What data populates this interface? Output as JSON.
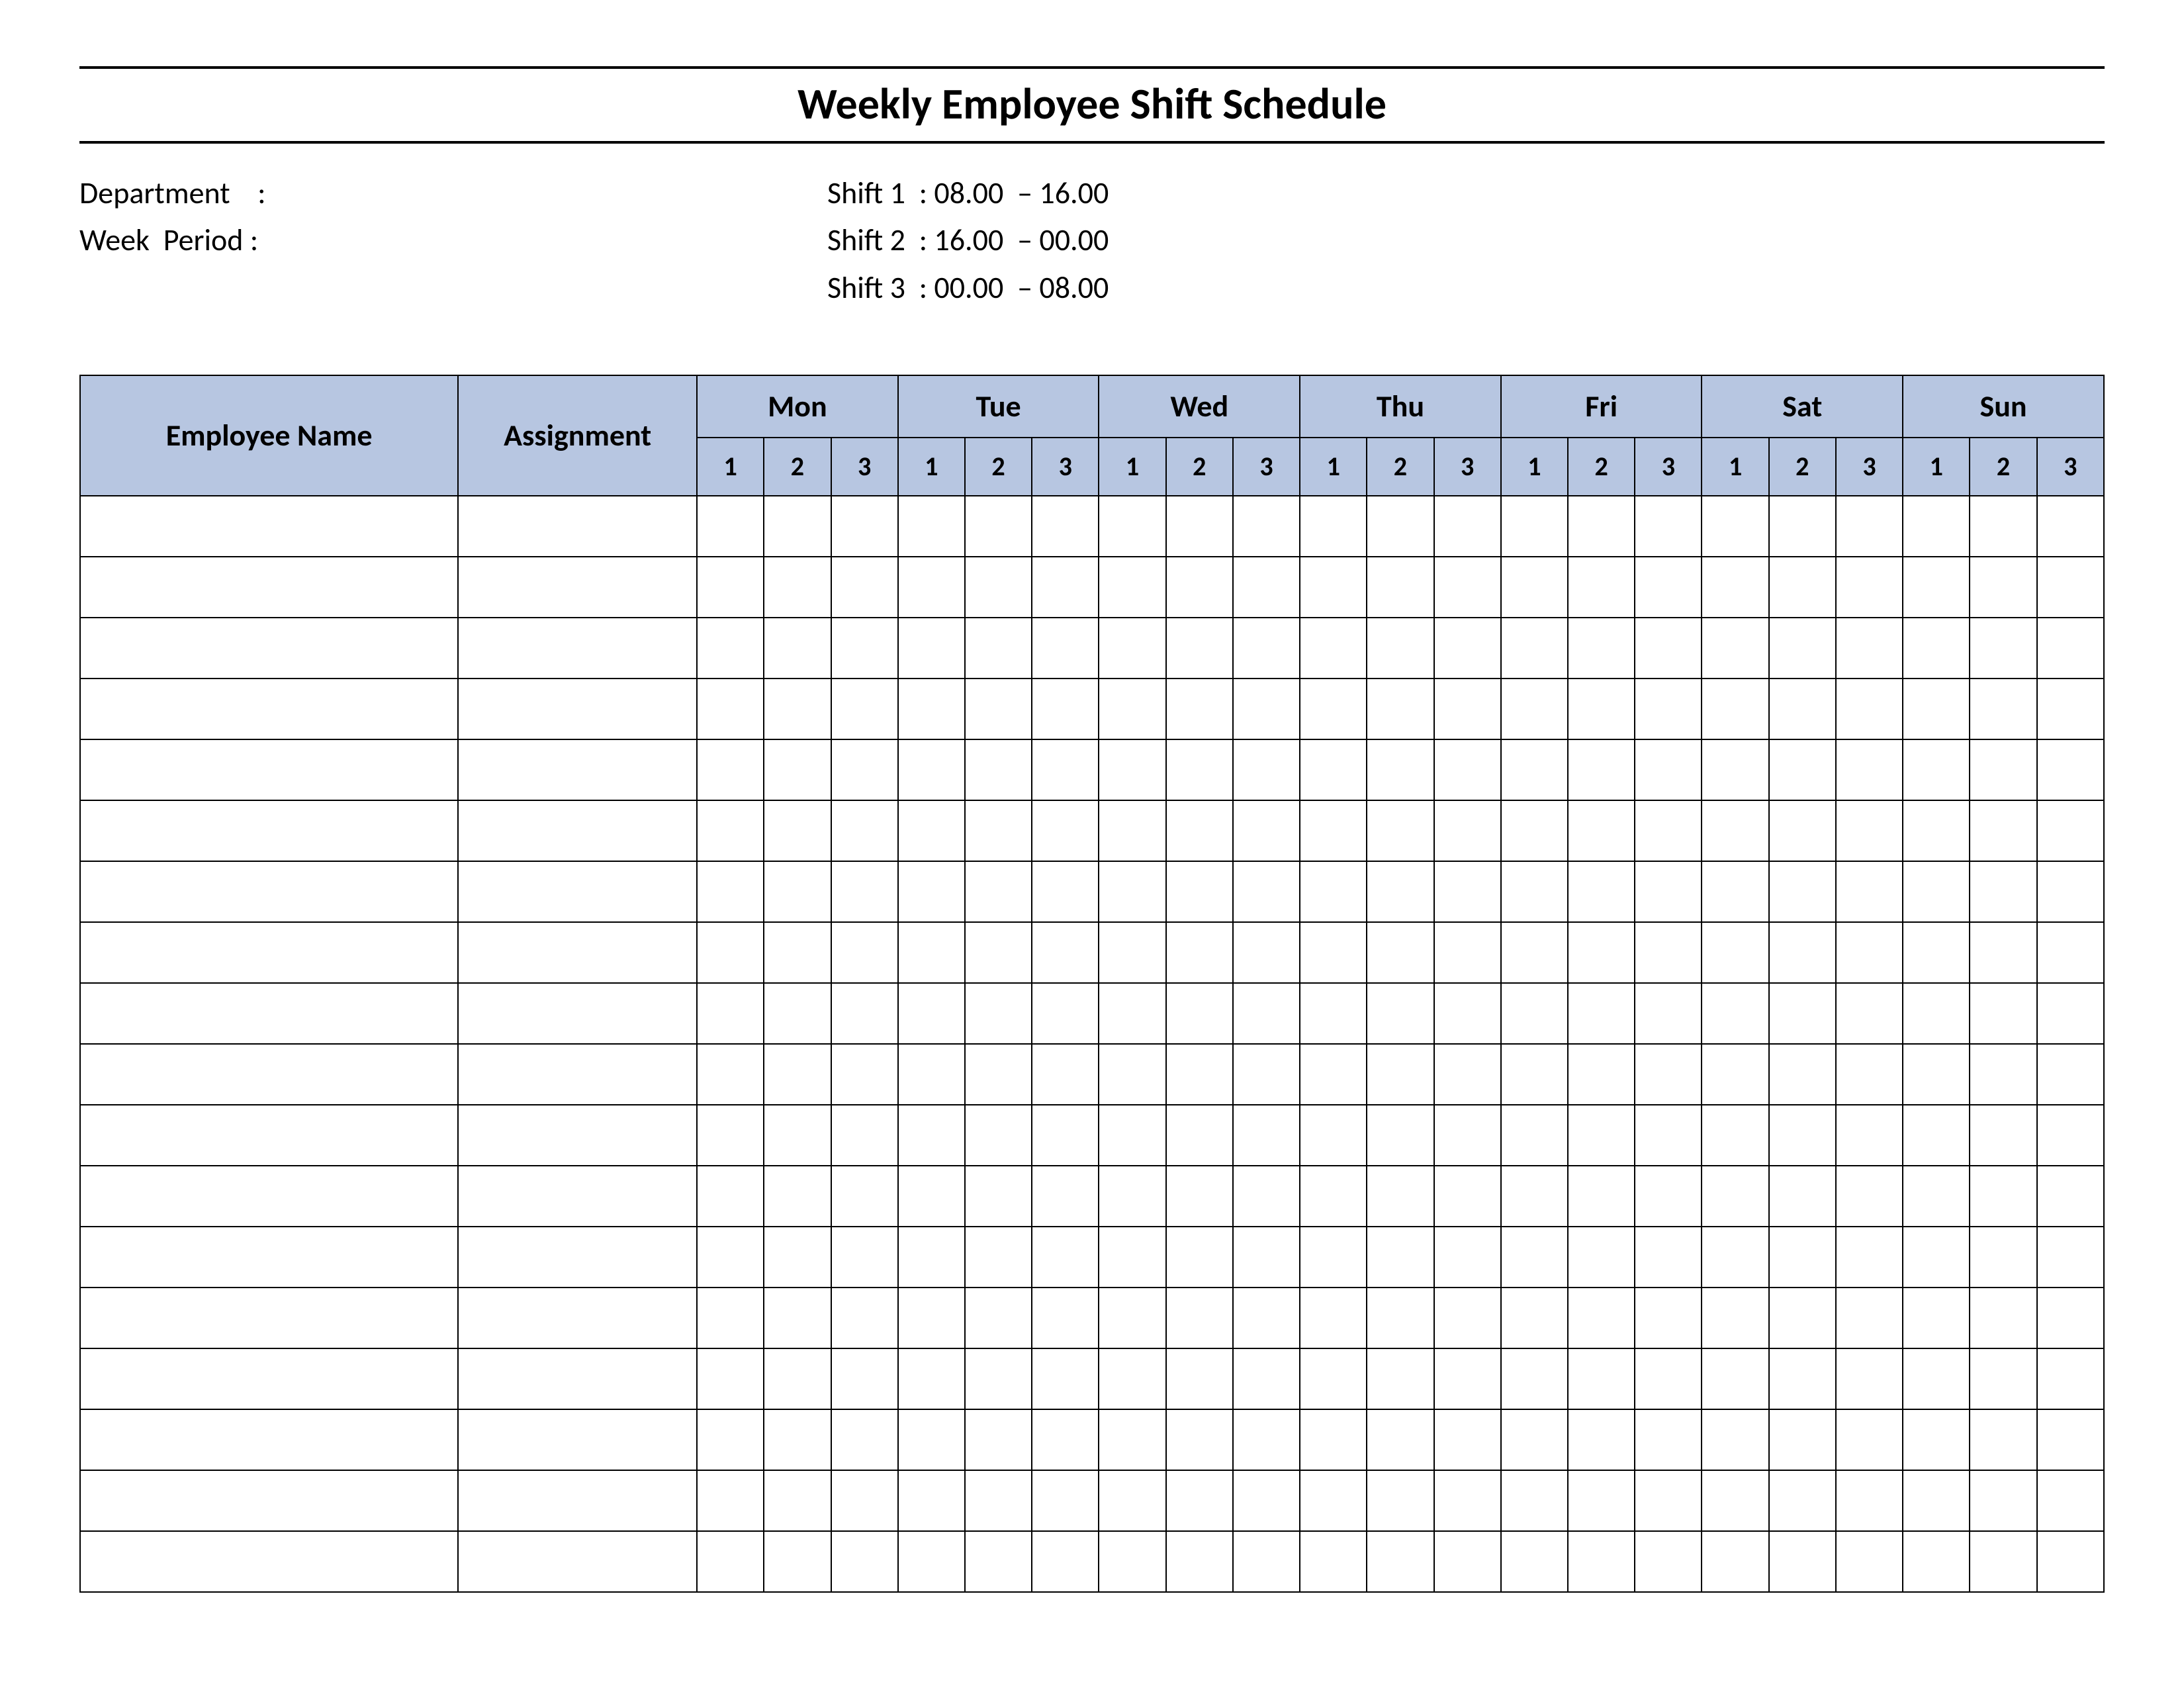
{
  "title": "Weekly Employee Shift Schedule",
  "meta": {
    "department_label": "Department    :",
    "week_label": "Week  Period :",
    "shift1": "Shift 1  : 08.00  – 16.00",
    "shift2": "Shift 2  : 16.00  – 00.00",
    "shift3": "Shift 3  : 00.00  – 08.00"
  },
  "headers": {
    "employee": "Employee Name",
    "assignment": "Assignment",
    "days": [
      "Mon",
      "Tue",
      "Wed",
      "Thu",
      "Fri",
      "Sat",
      "Sun"
    ],
    "sub": [
      "1",
      "2",
      "3"
    ]
  },
  "rows": 18
}
